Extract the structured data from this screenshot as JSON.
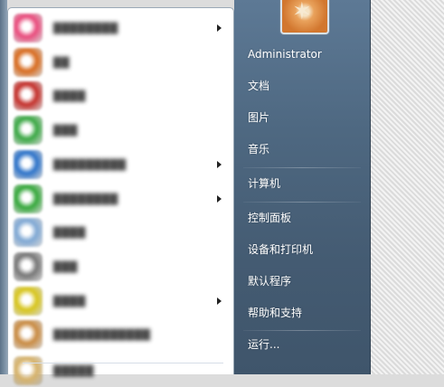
{
  "programs": [
    {
      "label": "████████",
      "has_submenu": true,
      "icon": "colorful-pinwheel-icon",
      "color": "#e94b7c"
    },
    {
      "label": "██",
      "has_submenu": false,
      "icon": "orange-app-icon",
      "color": "#d86b1f"
    },
    {
      "label": "████",
      "has_submenu": false,
      "icon": "penguin-icon",
      "color": "#c4302b"
    },
    {
      "label": "███",
      "has_submenu": false,
      "icon": "green-app-icon",
      "color": "#3aa844"
    },
    {
      "label": "█████████",
      "has_submenu": true,
      "icon": "blue-swirl-icon",
      "color": "#2d73c9"
    },
    {
      "label": "████████",
      "has_submenu": true,
      "icon": "green-circle-icon",
      "color": "#35a83b"
    },
    {
      "label": "████",
      "has_submenu": false,
      "icon": "document-icon",
      "color": "#7fa8d4"
    },
    {
      "label": "███",
      "has_submenu": false,
      "icon": "gear-icon",
      "color": "#777777"
    },
    {
      "label": "████",
      "has_submenu": true,
      "icon": "yellow-green-icon",
      "color": "#d7c51c"
    },
    {
      "label": "████████████",
      "has_submenu": false,
      "icon": "package-icon",
      "color": "#c98b42"
    },
    {
      "label": "█████",
      "has_submenu": false,
      "icon": "folder-icon",
      "color": "#d6b26a"
    }
  ],
  "places": {
    "user": "Administrator",
    "documents": "文档",
    "pictures": "图片",
    "music": "音乐",
    "computer": "计算机",
    "control_panel": "控制面板",
    "devices_printers": "设备和打印机",
    "default_programs": "默认程序",
    "help_support": "帮助和支持",
    "run": "运行..."
  }
}
